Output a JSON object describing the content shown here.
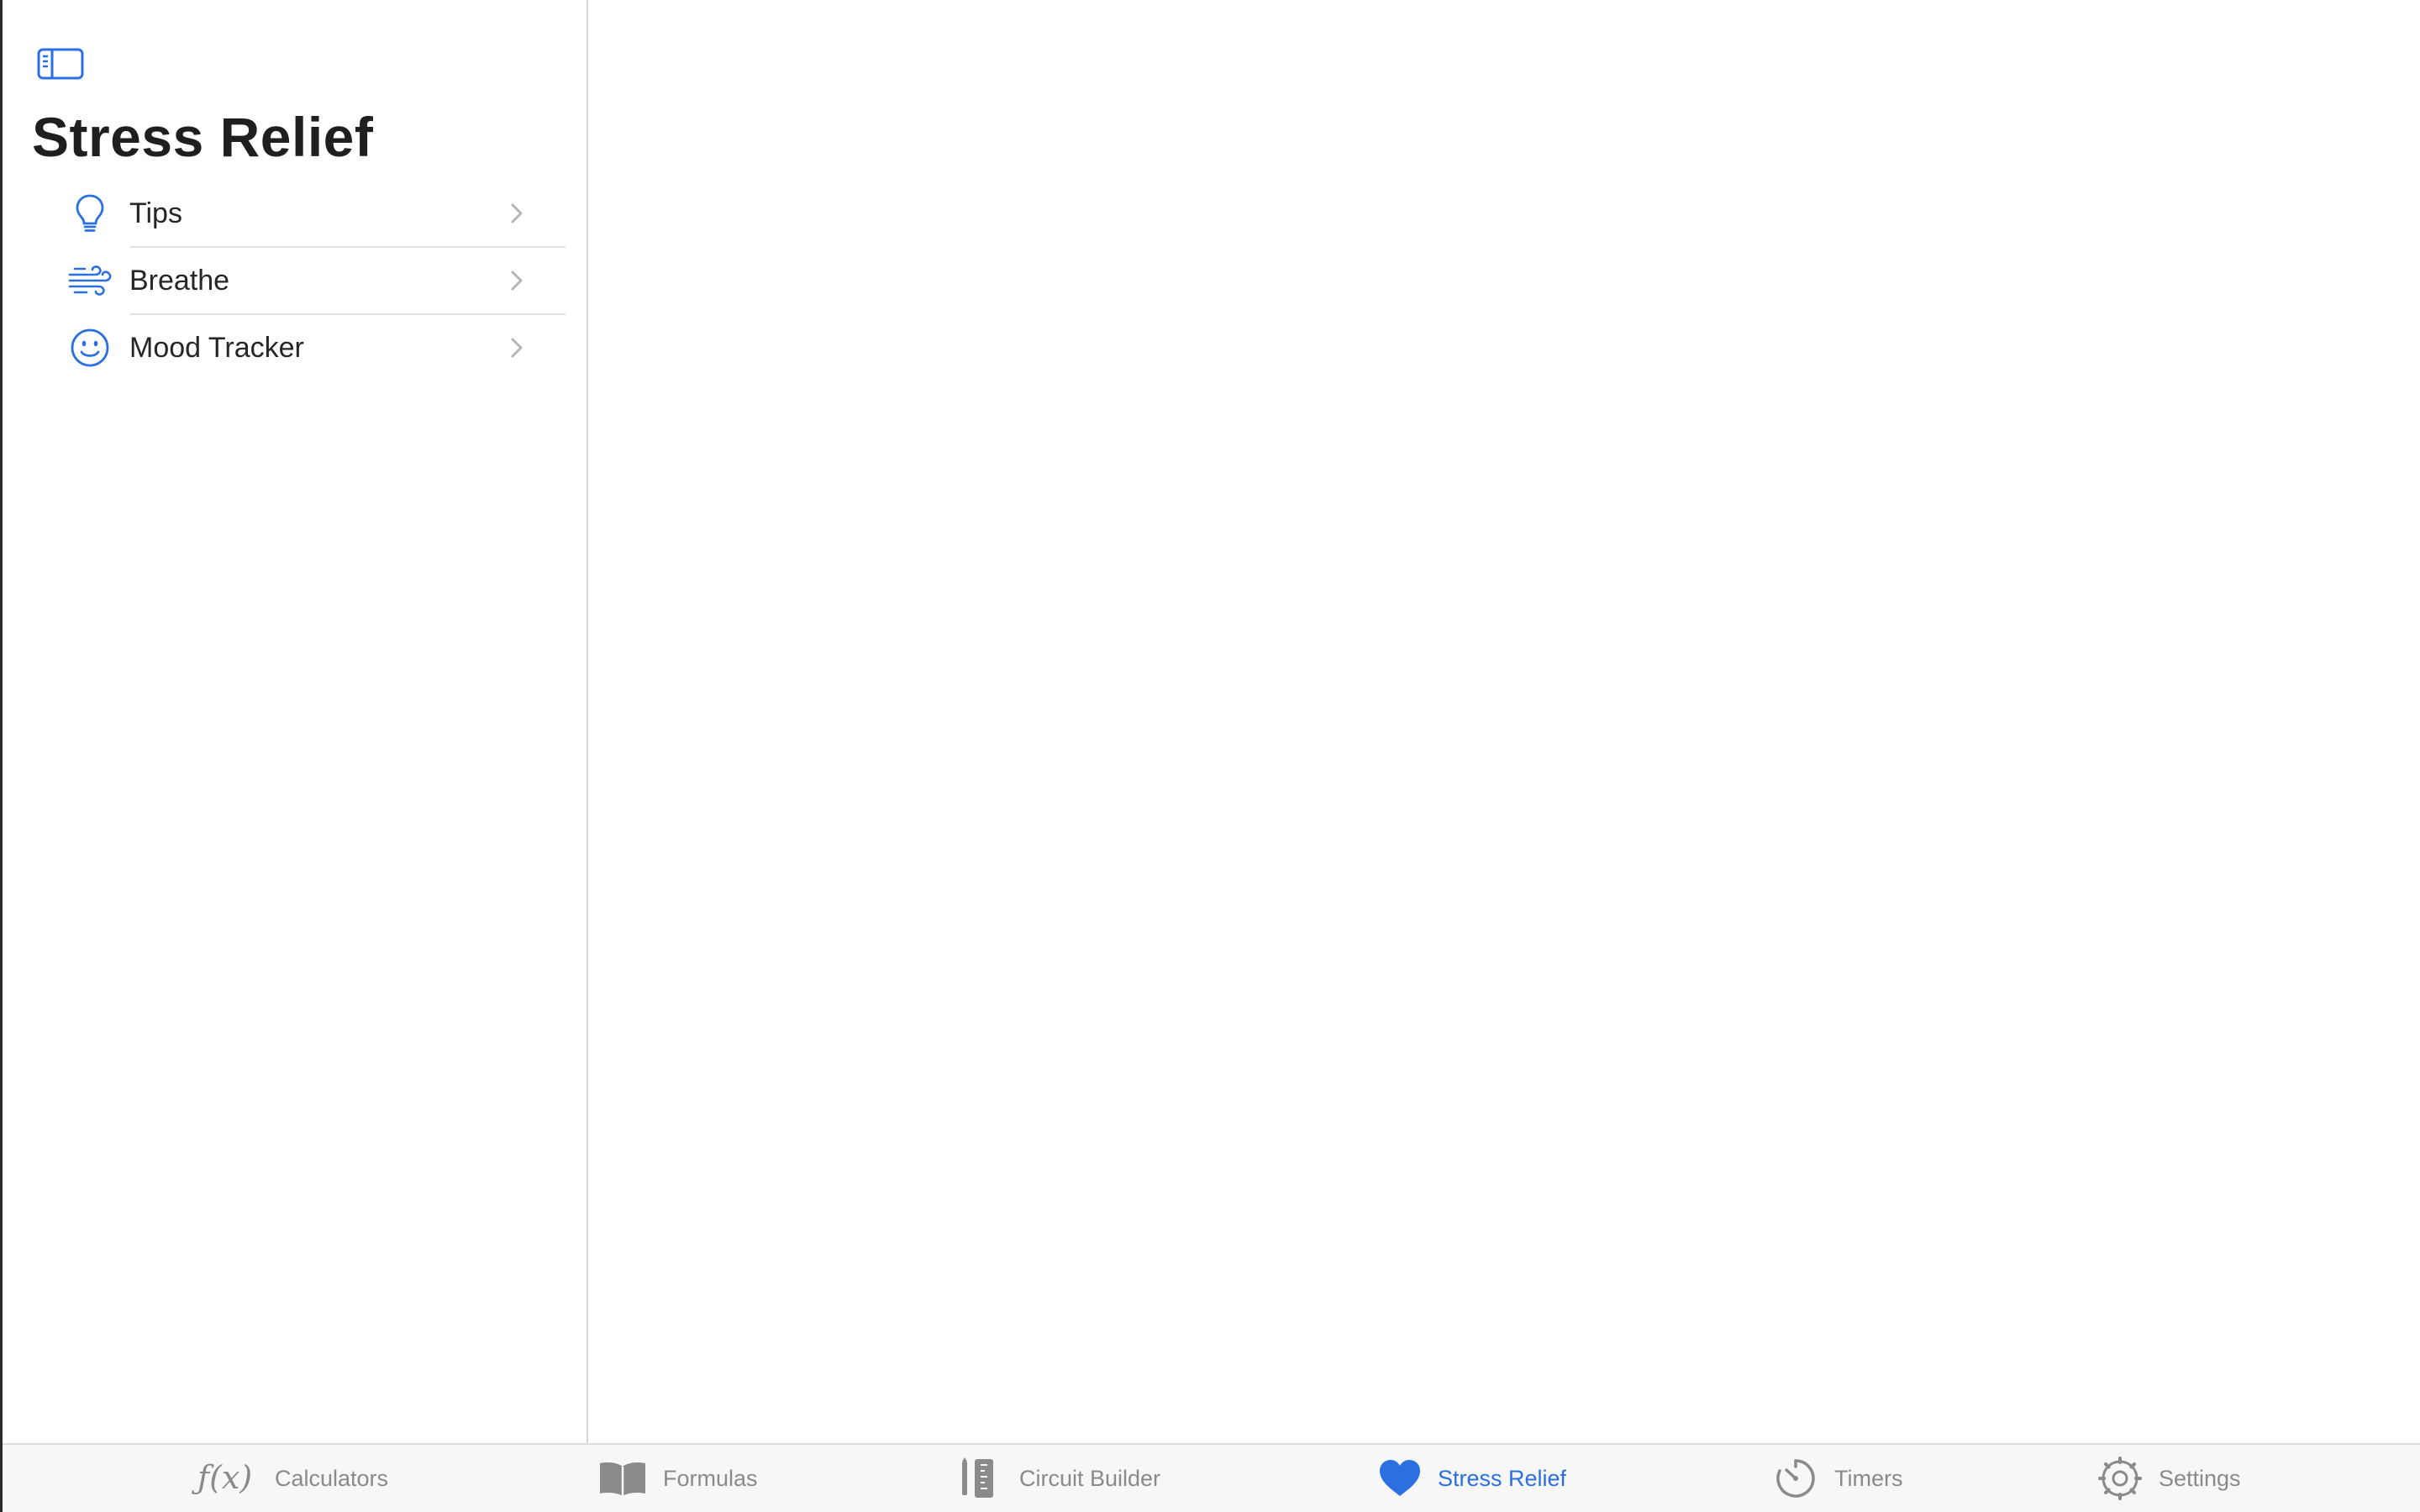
{
  "sidebar": {
    "toggle_icon": "sidebar-left-icon",
    "title": "Stress Relief",
    "items": [
      {
        "label": "Tips",
        "icon": "lightbulb-icon"
      },
      {
        "label": "Breathe",
        "icon": "wind-icon"
      },
      {
        "label": "Mood Tracker",
        "icon": "smiley-face-icon"
      }
    ]
  },
  "tabbar": {
    "tabs": [
      {
        "label": "Calculators",
        "icon": "function-fx-icon",
        "glyph": "ƒ(x)",
        "active": false
      },
      {
        "label": "Formulas",
        "icon": "book-icon",
        "active": false
      },
      {
        "label": "Circuit Builder",
        "icon": "ruler-pencil-icon",
        "active": false
      },
      {
        "label": "Stress Relief",
        "icon": "heart-icon",
        "active": true
      },
      {
        "label": "Timers",
        "icon": "timer-icon",
        "active": false
      },
      {
        "label": "Settings",
        "icon": "gear-icon",
        "active": false
      }
    ]
  },
  "colors": {
    "accent": "#2b6fe0",
    "inactive_tab": "#8a8a8a",
    "title_text": "#1f1f1f",
    "separator": "#e3e3e3"
  }
}
